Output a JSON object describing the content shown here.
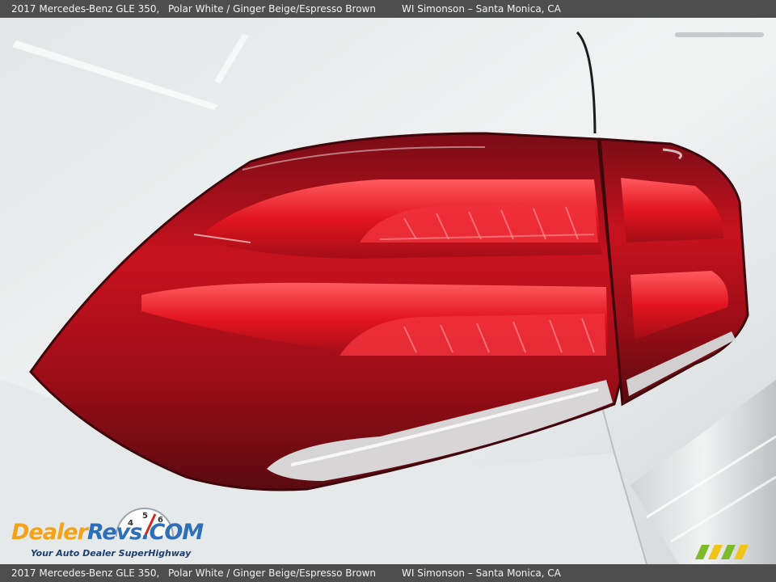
{
  "caption": {
    "model": "2017 Mercedes-Benz GLE 350,",
    "colors": "Polar White / Ginger Beige/Espresso Brown",
    "dealer": "WI Simonson – Santa Monica, CA"
  },
  "photo": {
    "subject": "tail-light-icon",
    "accent_colors": {
      "body_paint": "#eef0f0",
      "lens_red": "#c8101c",
      "lens_dark": "#5a0c12"
    }
  },
  "watermark": {
    "brand_text": "DealerRevs.com",
    "brand_parts": {
      "first": "Dealer",
      "second": "Revs",
      "suffix": ".COM"
    },
    "tagline": "Your Auto Dealer SuperHighway",
    "gauge_digits": [
      "4",
      "5",
      "6"
    ],
    "small_logo": "wm-logo-icon"
  }
}
